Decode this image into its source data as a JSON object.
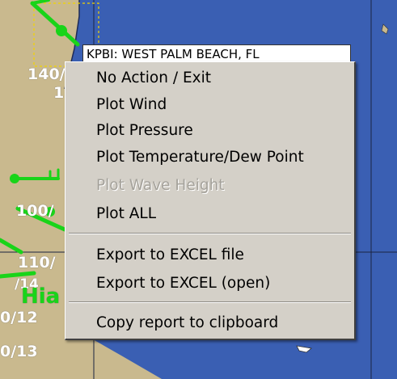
{
  "map": {
    "labels": [
      "140/",
      "1",
      "100/",
      "110/",
      "/14",
      "Hia",
      "0/12",
      "0/13"
    ],
    "station_tooltip": "KPBI: WEST PALM BEACH, FL"
  },
  "context_menu": {
    "items": [
      {
        "label": "No Action / Exit",
        "enabled": true
      },
      {
        "label": "Plot Wind",
        "enabled": true
      },
      {
        "label": "Plot Pressure",
        "enabled": true
      },
      {
        "label": "Plot Temperature/Dew Point",
        "enabled": true
      },
      {
        "label": "Plot Wave Height",
        "enabled": false
      },
      {
        "label": "Plot ALL",
        "enabled": true
      },
      {
        "label": "Export to EXCEL file",
        "enabled": true
      },
      {
        "label": "Export to EXCEL (open)",
        "enabled": true
      },
      {
        "label": "Copy report to clipboard",
        "enabled": true
      }
    ]
  },
  "colors": {
    "land": "#c9b98e",
    "ocean": "#3a5fb3",
    "wind_barb": "#19d419",
    "menu_background": "#d4d0c8",
    "disabled_text": "#a5a29b"
  }
}
